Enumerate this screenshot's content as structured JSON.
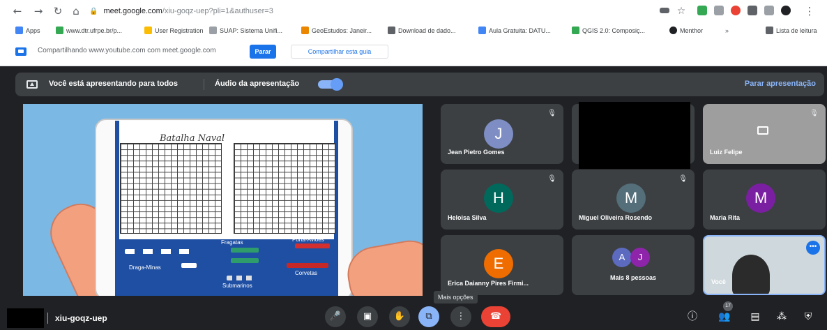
{
  "browser": {
    "url_host": "meet.google.com",
    "url_path": "/xiu-goqz-uep?pli=1&authuser=3",
    "bookmarks": [
      {
        "label": "Apps",
        "color": "#4285f4"
      },
      {
        "label": "www.dtr.ufrpe.br/p...",
        "color": "#34a853"
      },
      {
        "label": "User Registration",
        "color": "#fbbc04"
      },
      {
        "label": "SUAP: Sistema Unifi...",
        "color": "#9aa0a6"
      },
      {
        "label": "GeoEstudos: Janeir...",
        "color": "#ea8600"
      },
      {
        "label": "Download de dado...",
        "color": "#5f6368"
      },
      {
        "label": "Aula Gratuita: DATU...",
        "color": "#4285f4"
      },
      {
        "label": "QGIS 2.0: Composiç...",
        "color": "#34a853"
      },
      {
        "label": "Menthor",
        "color": "#202124"
      },
      {
        "label": "Lista de leitura",
        "color": "#5f6368"
      }
    ]
  },
  "share_bar": {
    "text": "Compartilhando www.youtube.com com meet.google.com",
    "stop_label": "Parar",
    "share_tab_label": "Compartilhar esta guia"
  },
  "banner": {
    "presenting_text": "Você está apresentando para todos",
    "audio_label": "Áudio da apresentação",
    "audio_on": true,
    "stop_label": "Parar apresentação"
  },
  "presentation": {
    "title": "Batalha Naval",
    "labels": {
      "fragatas": "Fragatas",
      "porta_avioes": "Porta-Aviões",
      "draga_minas": "Draga-Minas",
      "corvetas": "Corvetas",
      "submarinos": "Submarinos"
    }
  },
  "participants": [
    {
      "name": "Jean Pietro Gomes",
      "initial": "J",
      "color": "#7e8ec4",
      "muted": true
    },
    {
      "name": "Luiz Felipe",
      "initial": "",
      "color": "",
      "muted": true,
      "camera_off": true
    },
    {
      "name": "Heloisa Silva",
      "initial": "H",
      "color": "#00695c",
      "muted": true
    },
    {
      "name": "Miguel Oliveira Rosendo",
      "initial": "M",
      "color": "#546e7a",
      "muted": true
    },
    {
      "name": "Maria Rita",
      "initial": "M",
      "color": "#7b1fa2",
      "muted": false
    },
    {
      "name": "Erica Daianny Pires Firmi...",
      "initial": "E",
      "color": "#ef6c00",
      "muted": false
    },
    {
      "name": "Você",
      "initial": "",
      "color": "",
      "muted": false
    }
  ],
  "more_people": {
    "label": "Mais 8 pessoas",
    "initials": [
      "A",
      "J"
    ]
  },
  "bottom_bar": {
    "meeting_code": "xiu-goqz-uep",
    "tooltip": "Mais opções",
    "participant_count": "17"
  }
}
